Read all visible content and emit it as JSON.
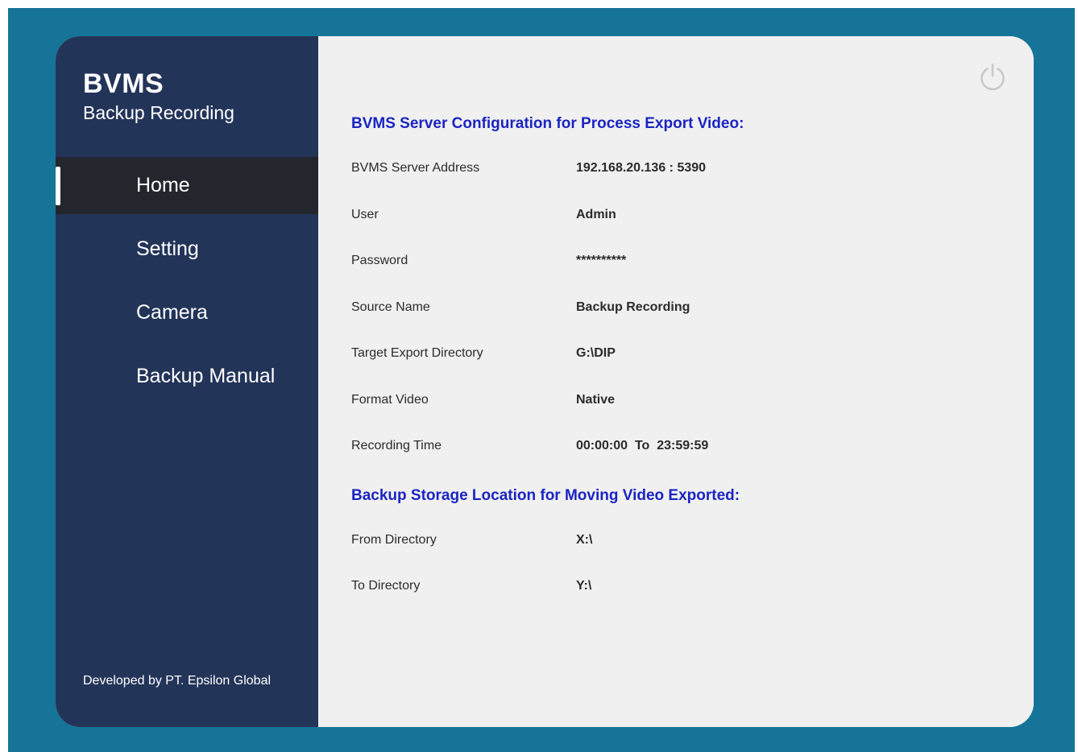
{
  "app": {
    "title": "BVMS",
    "subtitle": "Backup Recording"
  },
  "nav": {
    "items": [
      {
        "label": "Home",
        "active": true
      },
      {
        "label": "Setting",
        "active": false
      },
      {
        "label": "Camera",
        "active": false
      },
      {
        "label": "Backup Manual",
        "active": false
      }
    ]
  },
  "footer": {
    "credit": "Developed by PT. Epsilon Global"
  },
  "main": {
    "power_icon": "power-icon",
    "server_section": {
      "title": "BVMS Server Configuration for  Process Export Video:",
      "rows": [
        {
          "label": "BVMS Server Address",
          "value": "192.168.20.136 : 5390"
        },
        {
          "label": "User",
          "value": "Admin"
        },
        {
          "label": "Password",
          "value": "**********"
        },
        {
          "label": "Source Name",
          "value": "Backup Recording"
        },
        {
          "label": "Target Export Directory",
          "value": "G:\\DIP"
        },
        {
          "label": "Format Video",
          "value": "Native"
        },
        {
          "label": "Recording Time",
          "value": "00:00:00  To  23:59:59"
        }
      ]
    },
    "storage_section": {
      "title": "Backup Storage Location for Moving Video Exported:",
      "rows": [
        {
          "label": "From Directory",
          "value": "X:\\"
        },
        {
          "label": "To Directory",
          "value": "Y:\\"
        }
      ]
    }
  },
  "colors": {
    "backdrop": "#157497",
    "sidebar": "#233459",
    "sidebar_active": "#23262d",
    "content": "#f0f0f0",
    "section_title": "#1b24c2"
  }
}
